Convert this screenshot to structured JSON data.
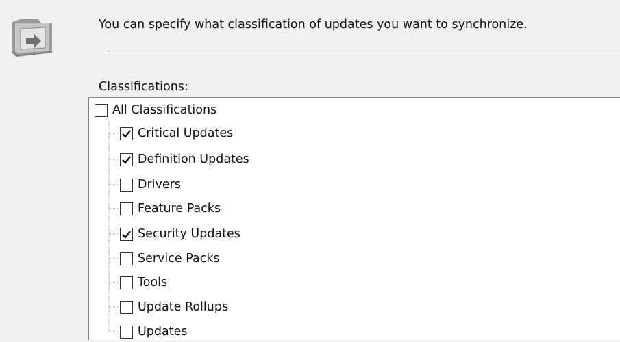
{
  "page": {
    "description": "You can specify what classification of updates you want to synchronize.",
    "list_label": "Classifications:"
  },
  "classifications": {
    "root": {
      "label": "All Classifications",
      "checked": false
    },
    "items": [
      {
        "label": "Critical Updates",
        "checked": true
      },
      {
        "label": "Definition Updates",
        "checked": true
      },
      {
        "label": "Drivers",
        "checked": false
      },
      {
        "label": "Feature Packs",
        "checked": false
      },
      {
        "label": "Security Updates",
        "checked": true
      },
      {
        "label": "Service Packs",
        "checked": false
      },
      {
        "label": "Tools",
        "checked": false
      },
      {
        "label": "Update Rollups",
        "checked": false
      },
      {
        "label": "Updates",
        "checked": false
      }
    ]
  },
  "icons": {
    "header": "folder-sync-icon",
    "check": "checkmark-icon"
  },
  "colors": {
    "background": "#f0f0f0",
    "list_background": "#ffffff",
    "checkbox_border": "#333333",
    "tree_lines": "#8c8c8c"
  }
}
